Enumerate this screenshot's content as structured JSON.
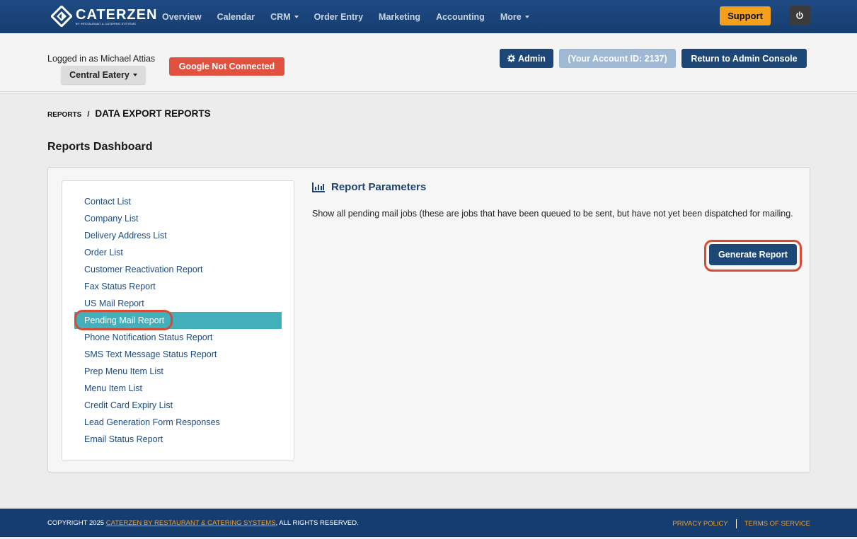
{
  "navbar": {
    "logo_text": "CATERZEN",
    "logo_subtext": "BY RESTAURANT & CATERING SYSTEMS",
    "links": [
      {
        "label": "Overview",
        "dropdown": false
      },
      {
        "label": "Calendar",
        "dropdown": false
      },
      {
        "label": "CRM",
        "dropdown": true
      },
      {
        "label": "Order Entry",
        "dropdown": false
      },
      {
        "label": "Marketing",
        "dropdown": false
      },
      {
        "label": "Accounting",
        "dropdown": false
      },
      {
        "label": "More",
        "dropdown": true
      }
    ],
    "support_label": "Support",
    "power_icon": "power-icon"
  },
  "account": {
    "logged_in_text": "Logged in as Michael Attias",
    "location_label": "Central Eatery",
    "google_label": "Google Not Connected",
    "admin_label": "Admin",
    "account_id_label": "(Your Account ID: 2137)",
    "return_label": "Return to Admin Console"
  },
  "breadcrumb": {
    "parent": "REPORTS",
    "separator": "/",
    "current": "DATA EXPORT REPORTS"
  },
  "page_title": "Reports Dashboard",
  "reports": {
    "items": [
      "Contact List",
      "Company List",
      "Delivery Address List",
      "Order List",
      "Customer Reactivation Report",
      "Fax Status Report",
      "US Mail Report",
      "Pending Mail Report",
      "Phone Notification Status Report",
      "SMS Text Message Status Report",
      "Prep Menu Item List",
      "Menu Item List",
      "Credit Card Expiry List",
      "Lead Generation Form Responses",
      "Email Status Report"
    ],
    "selected": "Pending Mail Report"
  },
  "params": {
    "title": "Report Parameters",
    "description": "Show all pending mail jobs (these are jobs that have been queued to be sent, but have not yet been dispatched for mailing.",
    "generate_label": "Generate Report"
  },
  "footer": {
    "copyright_prefix": "COPYRIGHT 2025 ",
    "company_link": "CATERZEN BY RESTAURANT & CATERING SYSTEMS",
    "copyright_suffix": ", ALL RIGHTS RESERVED.",
    "privacy_label": "PRIVACY POLICY",
    "terms_label": "TERMS OF SERVICE"
  },
  "colors": {
    "navbar": "#1e4a83",
    "primary_button": "#1c4777",
    "support": "#f5a01a",
    "danger": "#e0513f",
    "selected_item": "#42b0ba",
    "highlight_ring": "#d94a34",
    "footer_link": "#f0a030"
  }
}
